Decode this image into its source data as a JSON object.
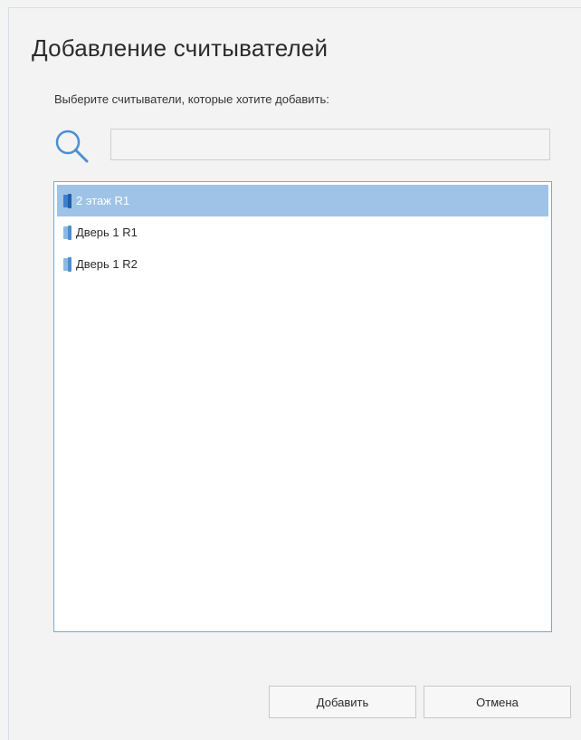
{
  "dialog": {
    "title": "Добавление считывателей",
    "instruction": "Выберите считыватели, которые хотите добавить:"
  },
  "search": {
    "value": "",
    "placeholder": "",
    "icon": "search-icon"
  },
  "readers": {
    "items": [
      {
        "label": "2 этаж R1",
        "selected": true,
        "icon": "reader-icon"
      },
      {
        "label": "Дверь 1 R1",
        "selected": false,
        "icon": "reader-icon"
      },
      {
        "label": "Дверь 1 R2",
        "selected": false,
        "icon": "reader-icon"
      }
    ]
  },
  "buttons": {
    "add_label": "Добавить",
    "cancel_label": "Отмена"
  },
  "colors": {
    "selection": "#9ec3e6",
    "accent": "#4a8fd4",
    "list_border": "#7fa7d0"
  }
}
